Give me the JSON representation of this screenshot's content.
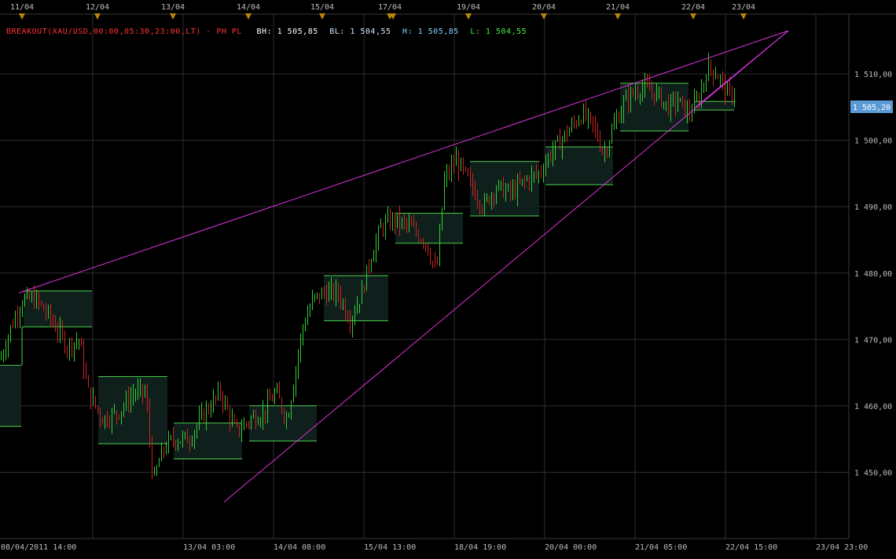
{
  "colors": {
    "background": "#000000",
    "grid": "#2e2e2e",
    "axis_text": "#bdbdbd",
    "up": "#33cc33",
    "down": "#cc2222",
    "breakout_line": "#4cd24c",
    "box_fill": "#0f1f1c",
    "box_red_fill": "#1f0a0a",
    "trendline": "#dd33dd",
    "marker": "#b8860b",
    "price_badge_bg": "#5b9bd5",
    "price_badge_text": "#ffffff",
    "header_name": "#ff3333",
    "header_bh": "#ffffff",
    "header_bl": "#cfe8ff",
    "header_h": "#7fd4ff",
    "header_l": "#44ee44"
  },
  "header": {
    "name": "BREAKOUT(XAU/USD,00:00,05:30,23:00,LT) - PH PL",
    "bh": "BH: 1 505,85",
    "bl": "BL: 1 504,55",
    "h": "H: 1 505,85",
    "l": "L: 1 504,55"
  },
  "price_badge": "1 505,20",
  "chart_data": {
    "type": "candlestick",
    "symbol": "XAU/USD",
    "ylim": [
      1440,
      1519
    ],
    "y_ticks": [
      1450,
      1460,
      1470,
      1480,
      1490,
      1500,
      1510
    ],
    "y_tick_labels": [
      "1 450,00",
      "1 460,00",
      "1 470,00",
      "1 480,00",
      "1 490,00",
      "1 500,00",
      "1 510,00"
    ],
    "x_range": [
      0,
      1080
    ],
    "top_day_labels": [
      {
        "label": "11/04",
        "x": 28
      },
      {
        "label": "12/04",
        "x": 124
      },
      {
        "label": "13/04",
        "x": 220
      },
      {
        "label": "14/04",
        "x": 316
      },
      {
        "label": "15/04",
        "x": 410
      },
      {
        "label": "17/04",
        "x": 496
      },
      {
        "label": "19/04",
        "x": 596
      },
      {
        "label": "20/04",
        "x": 692
      },
      {
        "label": "21/04",
        "x": 786
      },
      {
        "label": "22/04",
        "x": 882
      },
      {
        "label": "23/04",
        "x": 946
      }
    ],
    "bottom_labels": [
      {
        "label": "08/04/2011 14:00",
        "x": 1
      },
      {
        "label": "13/04 03:00",
        "x": 233
      },
      {
        "label": "14/04 08:00",
        "x": 348
      },
      {
        "label": "15/04 13:00",
        "x": 463
      },
      {
        "label": "18/04 19:00",
        "x": 578
      },
      {
        "label": "20/04 00:00",
        "x": 693
      },
      {
        "label": "21/04 05:00",
        "x": 808
      },
      {
        "label": "22/04 15:00",
        "x": 923
      },
      {
        "label": "23/04 23:00",
        "x": 1038
      }
    ],
    "breakout_boxes": [
      {
        "x0": 0,
        "x1": 27,
        "high": 1466.1,
        "low": 1456.9
      },
      {
        "x0": 30,
        "x1": 117,
        "high": 1477.3,
        "low": 1471.9
      },
      {
        "x0": 125,
        "x1": 213,
        "high": 1464.4,
        "low": 1454.3
      },
      {
        "x0": 221,
        "x1": 308,
        "high": 1457.4,
        "low": 1452.0
      },
      {
        "x0": 317,
        "x1": 403,
        "high": 1460.0,
        "low": 1454.7
      },
      {
        "x0": 412,
        "x1": 494,
        "high": 1479.6,
        "low": 1472.8
      },
      {
        "x0": 503,
        "x1": 589,
        "high": 1489.0,
        "low": 1484.5
      },
      {
        "x0": 598,
        "x1": 686,
        "high": 1496.8,
        "low": 1488.6
      },
      {
        "x0": 694,
        "x1": 780,
        "high": 1499.0,
        "low": 1493.3
      },
      {
        "x0": 789,
        "x1": 876,
        "high": 1508.6,
        "low": 1501.4
      },
      {
        "x0": 884,
        "x1": 934,
        "high": 1505.85,
        "low": 1504.55
      }
    ],
    "trendlines": [
      {
        "x0": 24,
        "y0": 1477.0,
        "x1": 1003,
        "y1": 1516.5
      },
      {
        "x0": 285,
        "y0": 1445.5,
        "x1": 1003,
        "y1": 1516.5
      },
      {
        "x0": 885,
        "y0": 1505.0,
        "x1": 1003,
        "y1": 1516.5
      }
    ],
    "candle_anchors": [
      [
        0,
        1467
      ],
      [
        14,
        1472
      ],
      [
        28,
        1476
      ],
      [
        45,
        1476
      ],
      [
        65,
        1473
      ],
      [
        85,
        1469
      ],
      [
        100,
        1470
      ],
      [
        112,
        1462
      ],
      [
        130,
        1458
      ],
      [
        150,
        1459
      ],
      [
        170,
        1462
      ],
      [
        185,
        1462
      ],
      [
        195,
        1448
      ],
      [
        200,
        1451
      ],
      [
        210,
        1454
      ],
      [
        222,
        1455
      ],
      [
        240,
        1455
      ],
      [
        260,
        1459
      ],
      [
        280,
        1462
      ],
      [
        300,
        1456
      ],
      [
        318,
        1458
      ],
      [
        335,
        1459
      ],
      [
        350,
        1462
      ],
      [
        365,
        1458
      ],
      [
        375,
        1465
      ],
      [
        385,
        1472
      ],
      [
        398,
        1476
      ],
      [
        412,
        1477
      ],
      [
        430,
        1477
      ],
      [
        445,
        1473
      ],
      [
        460,
        1477
      ],
      [
        470,
        1482
      ],
      [
        485,
        1487
      ],
      [
        500,
        1488
      ],
      [
        520,
        1487
      ],
      [
        540,
        1485
      ],
      [
        555,
        1480
      ],
      [
        565,
        1494
      ],
      [
        580,
        1497
      ],
      [
        600,
        1493
      ],
      [
        615,
        1490
      ],
      [
        630,
        1493
      ],
      [
        650,
        1492
      ],
      [
        668,
        1494
      ],
      [
        685,
        1495
      ],
      [
        700,
        1498
      ],
      [
        720,
        1501
      ],
      [
        740,
        1504
      ],
      [
        755,
        1502
      ],
      [
        768,
        1498
      ],
      [
        780,
        1502
      ],
      [
        795,
        1506
      ],
      [
        815,
        1508
      ],
      [
        835,
        1507
      ],
      [
        850,
        1505
      ],
      [
        862,
        1506
      ],
      [
        875,
        1504
      ],
      [
        888,
        1506
      ],
      [
        900,
        1511
      ],
      [
        912,
        1510
      ],
      [
        925,
        1507
      ],
      [
        934,
        1507
      ]
    ],
    "triangle_markers_x": [
      28,
      124,
      220,
      316,
      410,
      496,
      500,
      596,
      692,
      786,
      882,
      946
    ]
  }
}
